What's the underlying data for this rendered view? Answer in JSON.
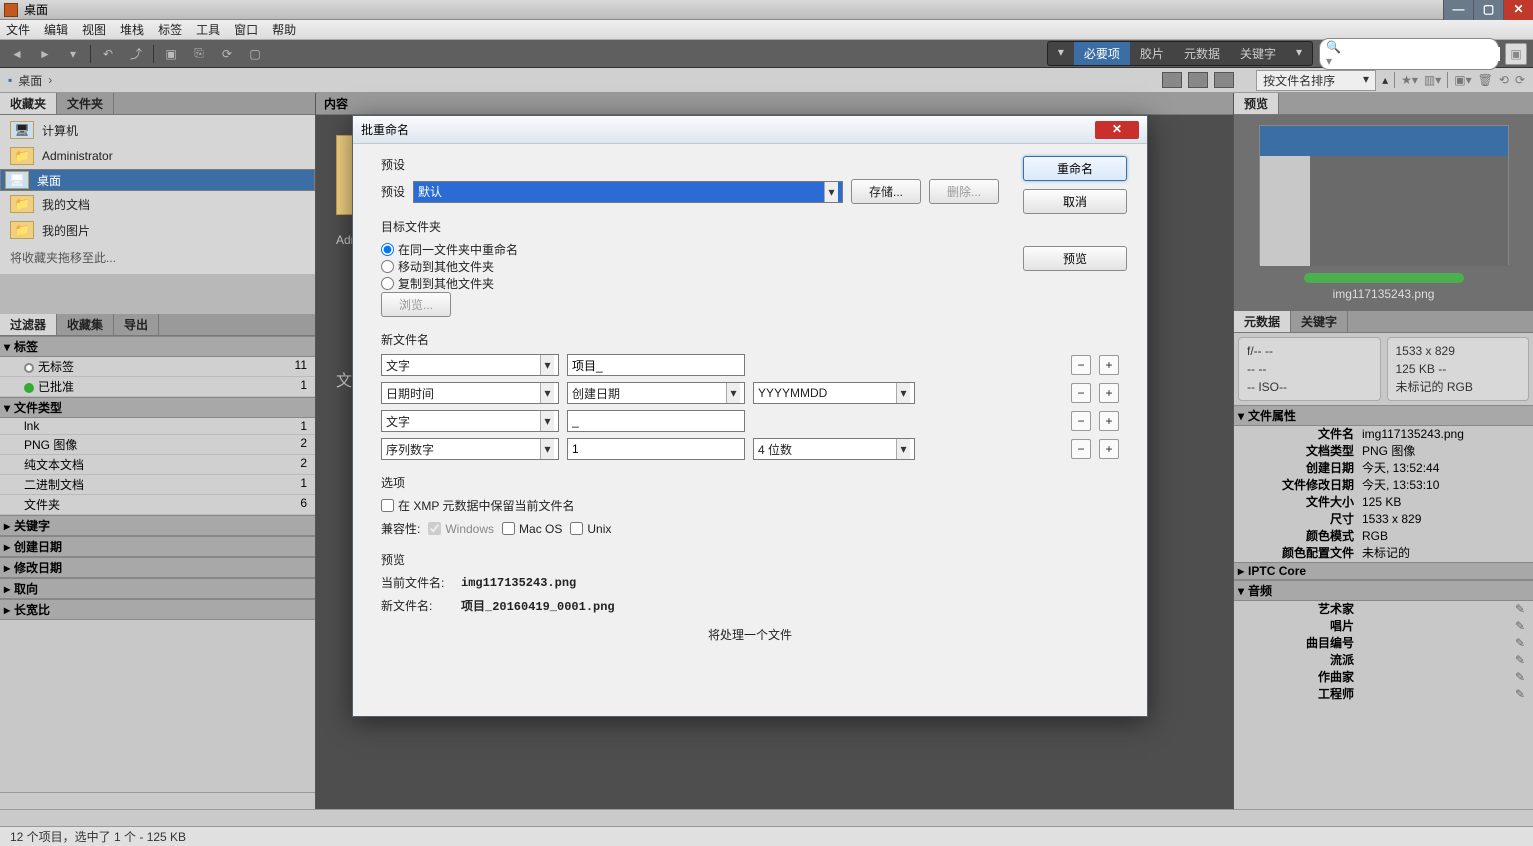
{
  "title": "桌面",
  "menus": [
    "文件",
    "编辑",
    "视图",
    "堆栈",
    "标签",
    "工具",
    "窗口",
    "帮助"
  ],
  "segmented": {
    "essential": "必要项",
    "film": "胶片",
    "metadata": "元数据",
    "keywords": "关键字"
  },
  "search_placeholder": "",
  "path": {
    "label": "桌面"
  },
  "sort": {
    "label": "按文件名排序"
  },
  "left": {
    "tabs": {
      "fav": "收藏夹",
      "folders": "文件夹"
    },
    "items": [
      {
        "icon": "computer",
        "label": "计算机"
      },
      {
        "icon": "folder",
        "label": "Administrator"
      },
      {
        "icon": "desktop",
        "label": "桌面"
      },
      {
        "icon": "folder",
        "label": "我的文档"
      },
      {
        "icon": "folder",
        "label": "我的图片"
      }
    ],
    "hint": "将收藏夹拖移至此...",
    "filter_tabs": {
      "filter": "过滤器",
      "collections": "收藏集",
      "export": "导出"
    },
    "groups": [
      {
        "title": "标签",
        "items": [
          {
            "label": "无标签",
            "count": 11,
            "dot": "#999",
            "stroke": true
          },
          {
            "label": "已批准",
            "count": 1,
            "dot": "#3a3"
          }
        ]
      },
      {
        "title": "文件类型",
        "items": [
          {
            "label": "lnk",
            "count": 1
          },
          {
            "label": "PNG 图像",
            "count": 2
          },
          {
            "label": "纯文本文档",
            "count": 2
          },
          {
            "label": "二进制文档",
            "count": 1
          },
          {
            "label": "文件夹",
            "count": 6
          }
        ]
      },
      {
        "title": "关键字"
      },
      {
        "title": "创建日期"
      },
      {
        "title": "修改日期"
      },
      {
        "title": "取向"
      },
      {
        "title": "长宽比"
      }
    ]
  },
  "center": {
    "header": "内容",
    "row1": "Admi"
  },
  "dialog": {
    "title": "批重命名",
    "buttons": {
      "rename": "重命名",
      "cancel": "取消",
      "preview": "预览"
    },
    "preset": {
      "label": "预设",
      "selected": "默认",
      "save": "存储...",
      "delete": "删除..."
    },
    "target": {
      "title": "目标文件夹",
      "same": "在同一文件夹中重命名",
      "move": "移动到其他文件夹",
      "copy": "复制到其他文件夹",
      "browse": "浏览..."
    },
    "newname": {
      "title": "新文件名",
      "rows": [
        {
          "c1": "文字",
          "c2": "项目_",
          "c3": ""
        },
        {
          "c1": "日期时间",
          "c2": "创建日期",
          "c3": "YYYYMMDD"
        },
        {
          "c1": "文字",
          "c2": "_",
          "c3": ""
        },
        {
          "c1": "序列数字",
          "c2": "1",
          "c3": "4 位数"
        }
      ]
    },
    "options": {
      "title": "选项",
      "xmp": "在 XMP 元数据中保留当前文件名",
      "compat": "兼容性:",
      "win": "Windows",
      "mac": "Mac OS",
      "unix": "Unix"
    },
    "preview": {
      "title": "预览",
      "curlabel": "当前文件名:",
      "cur": "img117135243.png",
      "newlabel": "新文件名:",
      "new": "项目_20160419_0001.png",
      "footer": "将处理一个文件"
    }
  },
  "right": {
    "preview_tab": "预览",
    "thumb_name": "img117135243.png",
    "meta_tabs": {
      "metadata": "元数据",
      "keywords": "关键字"
    },
    "box1": {
      "l1": "f/--    --",
      "l2": "--      --",
      "l3": "--      ISO--"
    },
    "box2": {
      "l1": "1533 x 829",
      "l2": "125 KB    --",
      "l3": "未标记的   RGB"
    },
    "groups": [
      {
        "title": "文件属性",
        "rows": [
          {
            "k": "文件名",
            "v": "img117135243.png"
          },
          {
            "k": "文档类型",
            "v": "PNG 图像"
          },
          {
            "k": "创建日期",
            "v": "今天, 13:52:44"
          },
          {
            "k": "文件修改日期",
            "v": "今天, 13:53:10"
          },
          {
            "k": "文件大小",
            "v": "125 KB"
          },
          {
            "k": "尺寸",
            "v": "1533 x 829"
          },
          {
            "k": "颜色模式",
            "v": "RGB"
          },
          {
            "k": "颜色配置文件",
            "v": "未标记的"
          }
        ]
      },
      {
        "title": "IPTC Core",
        "collapsed": true
      },
      {
        "title": "音频",
        "rows": [
          {
            "k": "艺术家",
            "v": "",
            "pen": true
          },
          {
            "k": "唱片",
            "v": "",
            "pen": true
          },
          {
            "k": "曲目编号",
            "v": "",
            "pen": true
          },
          {
            "k": "流派",
            "v": "",
            "pen": true
          },
          {
            "k": "作曲家",
            "v": "",
            "pen": true
          },
          {
            "k": "工程师",
            "v": "",
            "pen": true
          }
        ]
      }
    ]
  },
  "status": "12 个项目，选中了 1 个 - 125 KB"
}
